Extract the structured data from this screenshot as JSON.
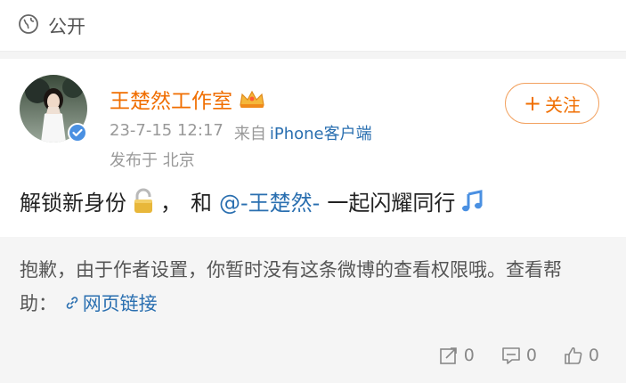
{
  "visibility": {
    "label": "公开",
    "icon": "globe-icon"
  },
  "author": {
    "name": "王楚然工作室",
    "verified": true,
    "vip_badge": "crown-icon",
    "name_color": "#f06e00"
  },
  "meta": {
    "time": "23-7-15 12:17",
    "from_label": "来自",
    "source": "iPhone客户端",
    "location": "发布于 北京"
  },
  "follow": {
    "plus": "+",
    "label": "关注"
  },
  "post": {
    "text_before": "解锁新身份",
    "comma": "，",
    "and": "和",
    "mention": "@-王楚然-",
    "text_after": "一起闪耀同行"
  },
  "restricted": {
    "message": "抱歉，由于作者设置，你暂时没有这条微博的查看权限哦。查看帮助：",
    "help_link": "网页链接"
  },
  "actions": {
    "share_count": "0",
    "comment_count": "0",
    "like_count": "0"
  },
  "colors": {
    "accent": "#f06e00",
    "link": "#2a6fb0",
    "muted": "#999999"
  }
}
